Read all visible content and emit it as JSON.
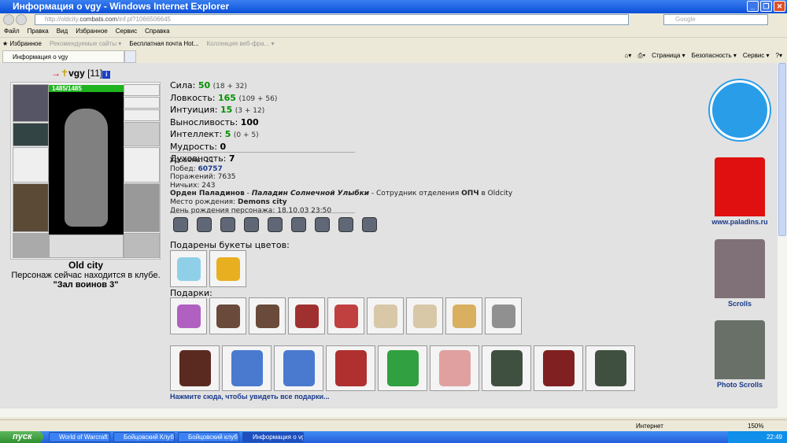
{
  "window": {
    "title": "Информация о vgy - Windows Internet Explorer"
  },
  "address": {
    "url_prefix": "http://oldcity.",
    "url_domain": "combats.com",
    "url_path": "/inf.pl?1066506645",
    "search_placeholder": "Google"
  },
  "menu": [
    "Файл",
    "Правка",
    "Вид",
    "Избранное",
    "Сервис",
    "Справка"
  ],
  "favorites": {
    "label": "Избранное",
    "items": [
      "Рекомендуемые сайты ▾",
      "Бесплатная почта Hot...",
      "Коллекция веб-фра... ▾"
    ]
  },
  "tab": {
    "label": "Информация о vgy"
  },
  "commandbar": [
    "Страница ▾",
    "Безопасность ▾",
    "Сервис ▾"
  ],
  "character": {
    "nick": "vgy",
    "level": "[11]",
    "info_icon": "i",
    "hp": "1485/1485",
    "city": "Old city",
    "location_text": "Персонаж сейчас находится в клубе.",
    "room": "\"Зал воинов 3\""
  },
  "stats": [
    {
      "label": "Сила: ",
      "value": "50",
      "detail": "(18 + 32)",
      "green": true
    },
    {
      "label": "Ловкость: ",
      "value": "165",
      "detail": "(109 + 56)",
      "green": true
    },
    {
      "label": "Интуиция: ",
      "value": "15",
      "detail": "(3 + 12)",
      "green": true
    },
    {
      "label": "Выносливость: ",
      "value": "100",
      "detail": "",
      "green": false
    },
    {
      "label": "Интеллект: ",
      "value": "5",
      "detail": "(0 + 5)",
      "green": true
    },
    {
      "label": "Мудрость: ",
      "value": "0",
      "detail": "",
      "green": false
    },
    {
      "label": "Духовность: ",
      "value": "7",
      "detail": "",
      "green": false
    }
  ],
  "info": {
    "level": "Уровень: 11",
    "wins_label": "Побед: ",
    "wins": "60757",
    "losses": "Поражений: 7635",
    "draws": "Ничьих: 243",
    "order": "Орден Паладинов",
    "dash1": " - ",
    "rank": "Паладин Солнечной Улыбки",
    "dash2": " - Сотрудник отделения ",
    "dept": "ОПЧ",
    "in_city": " в Oldcity",
    "birthplace_label": "Место рождения: ",
    "birthplace": "Demons city",
    "birthday": "День рождения персонажа: 18.10.03 23:50"
  },
  "flowers_title": "Подарены букеты цветов:",
  "gifts_title": "Подарки:",
  "more_link": "Нажмите сюда, чтобы увидеть все подарки...",
  "sidebar": {
    "paladins": "www.paladins.ru",
    "scrolls": "Scrolls",
    "photo": "Photo Scrolls"
  },
  "status": {
    "zone": "Интернет",
    "zoom": "150%"
  },
  "taskbar": {
    "start": "пуск",
    "tasks": [
      "World of Warcraft",
      "Бойцовский Клуб ...",
      "Бойцовский клуб ...",
      "Информация о vg..."
    ],
    "time": "22:49"
  },
  "colors": {
    "flowers": [
      "#8fd0e8",
      "#e8b020"
    ],
    "gifts1": [
      "#b060c0",
      "#6a4a3a",
      "#6a4a3a",
      "#a03030",
      "#c04040",
      "#d8c8a8",
      "#d8c8a8",
      "#d8b060",
      "#909090"
    ],
    "gifts2": [
      "#5a2a20",
      "#4a7ad0",
      "#4a7ad0",
      "#b03030",
      "#30a040",
      "#e0a0a0",
      "#405040",
      "#802020",
      "#405040"
    ]
  }
}
